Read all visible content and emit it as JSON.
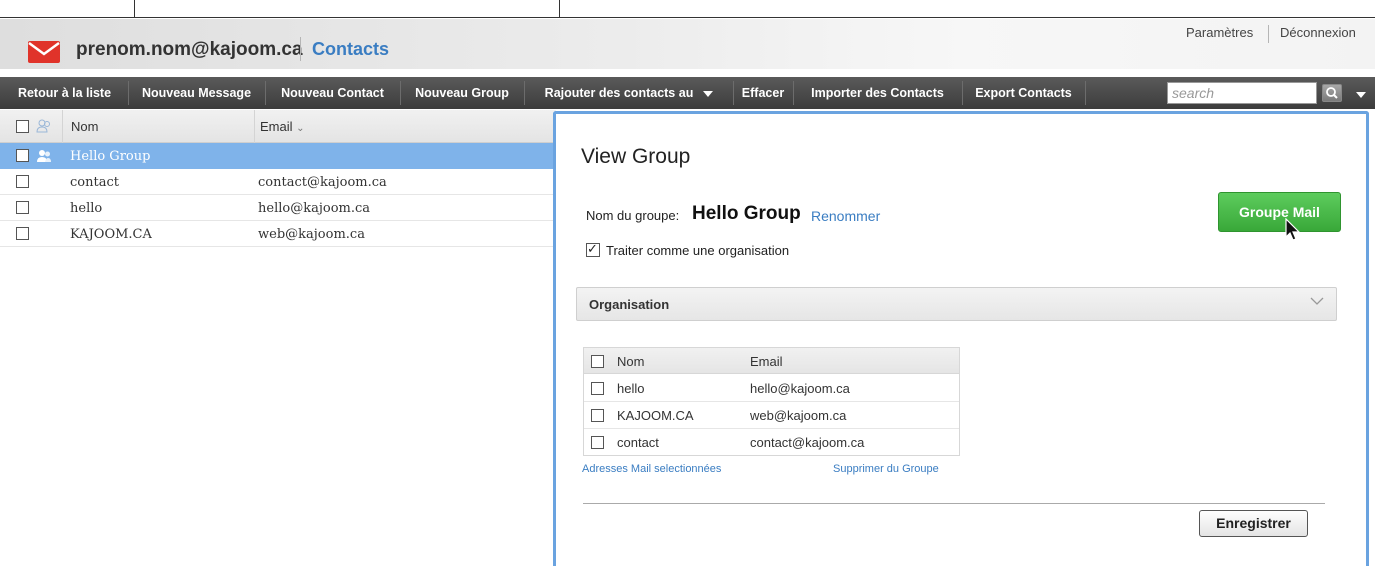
{
  "header": {
    "account_email": "prenom.nom@kajoom.ca",
    "section_title": "Contacts",
    "settings_label": "Paramètres",
    "logout_label": "Déconnexion"
  },
  "toolbar": {
    "items": [
      {
        "label": "Retour à la liste"
      },
      {
        "label": "Nouveau Message"
      },
      {
        "label": "Nouveau Contact"
      },
      {
        "label": "Nouveau Group"
      },
      {
        "label": "Rajouter des contacts au"
      },
      {
        "label": "Effacer"
      },
      {
        "label": "Importer des Contacts"
      },
      {
        "label": "Export Contacts"
      }
    ],
    "search_placeholder": "search"
  },
  "contact_list": {
    "columns": {
      "name": "Nom",
      "email": "Email"
    },
    "rows": [
      {
        "name": "Hello Group",
        "email": "",
        "type": "group",
        "selected": true
      },
      {
        "name": "contact",
        "email": "contact@kajoom.ca",
        "type": "contact",
        "selected": false
      },
      {
        "name": "hello",
        "email": "hello@kajoom.ca",
        "type": "contact",
        "selected": false
      },
      {
        "name": "KAJOOM.CA",
        "email": "web@kajoom.ca",
        "type": "contact",
        "selected": false
      }
    ]
  },
  "group_view": {
    "title": "View Group",
    "group_name_label": "Nom du groupe:",
    "group_name": "Hello Group",
    "rename_label": "Renommer",
    "mail_button_label": "Groupe Mail",
    "organisation_checkbox_label": "Traiter comme une organisation",
    "organisation_checked": true,
    "organisation_section_title": "Organisation",
    "members_table": {
      "columns": {
        "name": "Nom",
        "email": "Email"
      },
      "rows": [
        {
          "name": "hello",
          "email": "hello@kajoom.ca"
        },
        {
          "name": "KAJOOM.CA",
          "email": "web@kajoom.ca"
        },
        {
          "name": "contact",
          "email": "contact@kajoom.ca"
        }
      ]
    },
    "selected_addresses_link": "Adresses Mail selectionnées",
    "remove_from_group_link": "Supprimer du Groupe",
    "save_button_label": "Enregistrer"
  },
  "colors": {
    "accent_blue": "#3a7dc2",
    "selected_row": "#7fb3ea",
    "toolbar_bg": "#4a4a4a",
    "mail_icon_red": "#e0332a",
    "green_button": "#43b443"
  }
}
